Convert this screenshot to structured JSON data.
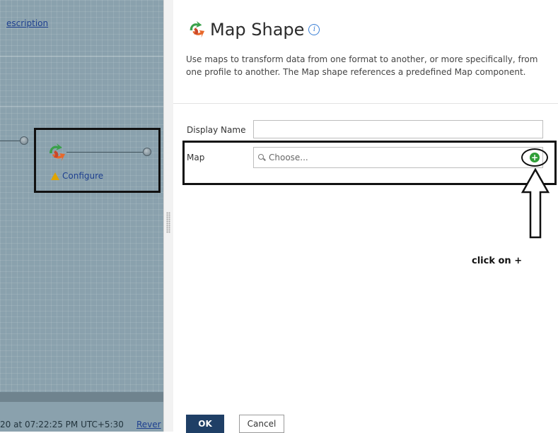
{
  "canvas": {
    "top_link": "escription",
    "configure_label": "Configure",
    "footer_time": "20 at 07:22:25 PM UTC+5:30",
    "footer_link": "Rever"
  },
  "panel": {
    "title": "Map Shape",
    "info_icon": "i",
    "description": "Use maps to transform data from one format to another, or more specifically, from one profile to another. The Map shape references a predefined Map component.",
    "fields": {
      "display_name_label": "Display Name",
      "display_name_value": "",
      "map_label": "Map",
      "map_placeholder": "Choose..."
    },
    "add_icon": "+",
    "annotation": "click on +",
    "ok_label": "OK",
    "cancel_label": "Cancel"
  },
  "colors": {
    "canvas_bg": "#8aa1ad",
    "ok_button": "#1f3f66",
    "add_icon": "#2f9e37",
    "warning": "#e0a400"
  },
  "icons": [
    "map-shape-icon",
    "info-icon",
    "warning-icon",
    "search-icon",
    "plus-circle-icon",
    "up-arrow-icon"
  ]
}
